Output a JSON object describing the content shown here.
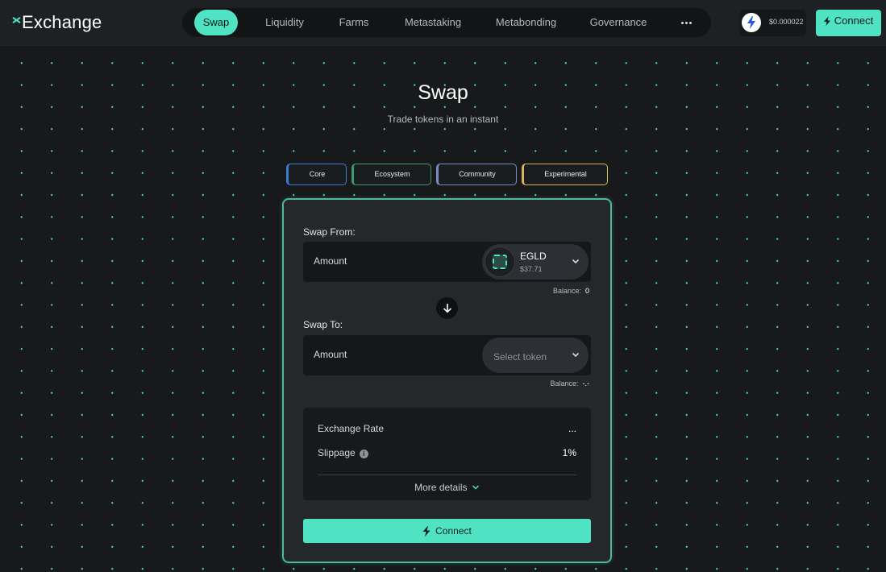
{
  "header": {
    "logo_text": "Exchange",
    "nav": [
      {
        "label": "Swap",
        "active": true
      },
      {
        "label": "Liquidity",
        "active": false
      },
      {
        "label": "Farms",
        "active": false
      },
      {
        "label": "Metastaking",
        "active": false
      },
      {
        "label": "Metabonding",
        "active": false
      },
      {
        "label": "Governance",
        "active": false
      }
    ],
    "more_icon": "ellipsis-icon",
    "token_price": "$0.000022",
    "token_icon": "lightning-icon",
    "connect_label": "Connect"
  },
  "page": {
    "title": "Swap",
    "subtitle": "Trade tokens in an instant"
  },
  "pools": [
    {
      "label": "Core",
      "color": "#3a7bd5"
    },
    {
      "label": "Ecosystem",
      "color": "#3f9b6e"
    },
    {
      "label": "Community",
      "color": "#7c8bc4"
    },
    {
      "label": "Experimental",
      "color": "#d9b35a"
    }
  ],
  "swap": {
    "from_label": "Swap From:",
    "from_placeholder": "Amount",
    "from_token": {
      "name": "EGLD",
      "price": "$37.71"
    },
    "from_balance_label": "Balance:",
    "from_balance_value": "0",
    "to_label": "Swap To:",
    "to_placeholder": "Amount",
    "to_token_placeholder": "Select token",
    "to_balance_label": "Balance:",
    "to_balance_value": "-.-",
    "exchange_rate_label": "Exchange Rate",
    "exchange_rate_value": "...",
    "slippage_label": "Slippage",
    "slippage_value": "1%",
    "more_details_label": "More details",
    "connect_label": "Connect"
  },
  "colors": {
    "accent": "#4fe3c4",
    "background": "#17191b",
    "card": "#25282b"
  }
}
